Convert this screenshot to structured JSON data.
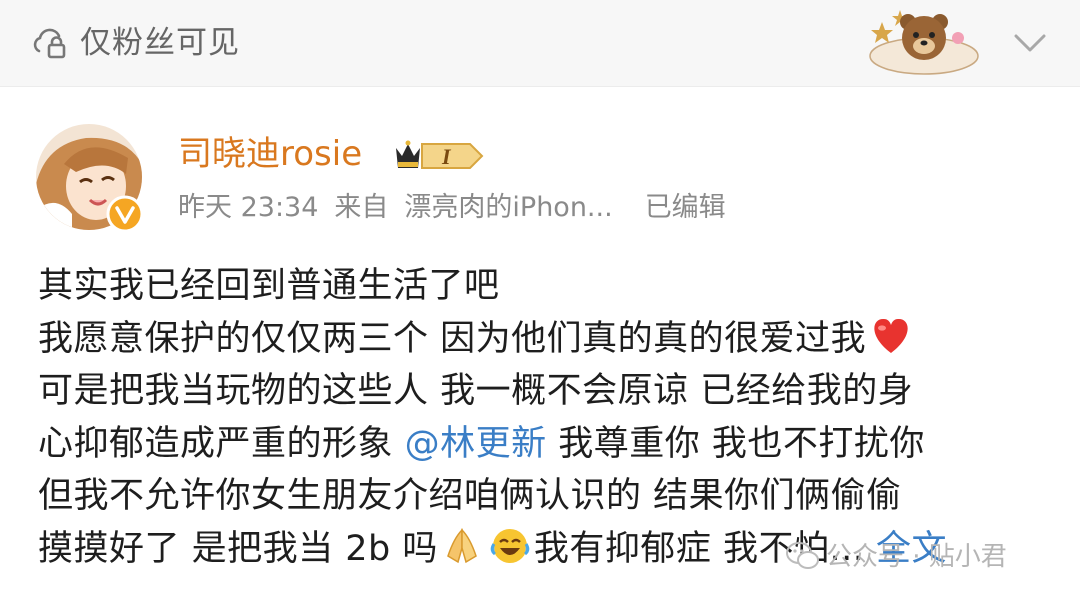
{
  "header": {
    "visibility_label": "仅粉丝可见"
  },
  "post": {
    "author": {
      "name": "司晓迪rosie",
      "level": "I"
    },
    "time": "昨天 23:34",
    "source_prefix": "来自",
    "source": "漂亮肉的iPhon...",
    "edited": "已编辑",
    "lines": [
      "其实我已经回到普通生活了吧",
      "我愿意保护的仅仅两三个 因为他们真的真的很爱过我",
      "可是把我当玩物的这些人 我一概不会原谅 已经给我的身",
      "心抑郁造成严重的形象 ",
      "但我不允许你女生朋友介绍咱俩认识的 结果你们俩偷偷",
      "摸摸好了 是把我当 2b 吗"
    ],
    "mention": "@林更新",
    "line4_suffix": " 我尊重你 我也不打扰你",
    "line6_suffix": "我有抑郁症 我不怕...",
    "full_text_link": "全文"
  },
  "watermark": {
    "text": "公众号 · 贴小君"
  },
  "colors": {
    "username": "#d9781f",
    "link": "#3a7ec6",
    "meta": "#8a8a8a"
  }
}
